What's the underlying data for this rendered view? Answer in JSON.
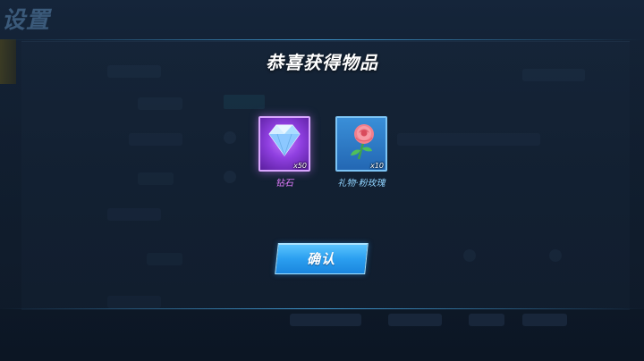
{
  "background": {
    "screen_title": "设置"
  },
  "modal": {
    "title": "恭喜获得物品",
    "rewards": [
      {
        "name": "钻石",
        "quantity": "x50",
        "icon": "diamond-icon",
        "rarity_color": "#b45cf2"
      },
      {
        "name": "礼物·粉玫瑰",
        "quantity": "x10",
        "icon": "pink-rose-icon",
        "rarity_color": "#2f7fd0"
      }
    ],
    "confirm_label": "确认"
  },
  "colors": {
    "accent": "#2b9ff0",
    "purple_rarity": "#b45cf2",
    "blue_rarity": "#2f7fd0"
  }
}
